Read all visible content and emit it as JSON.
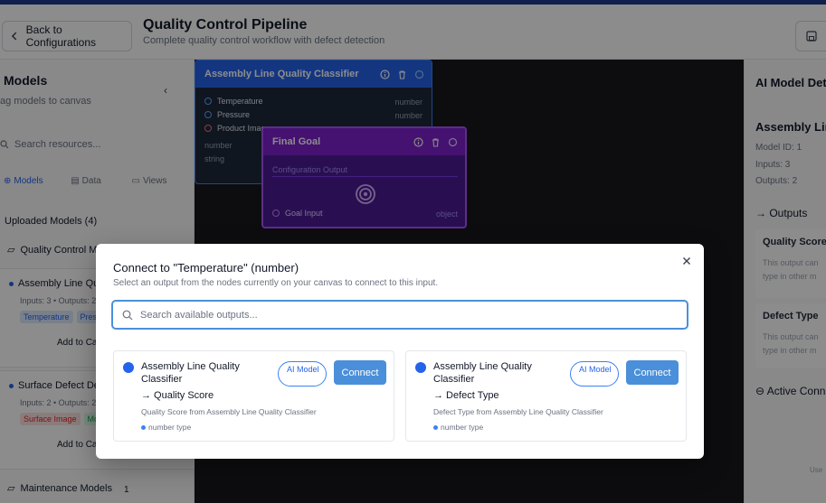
{
  "header": {
    "back_label": "Back to Configurations",
    "title": "Quality Control Pipeline",
    "subtitle": "Complete quality control workflow with defect detection"
  },
  "sidebar": {
    "title": "Models",
    "subtitle": "ag models to canvas",
    "search_placeholder": "Search resources...",
    "tabs": [
      "Models",
      "Data",
      "Views"
    ],
    "section_title": "Uploaded Models (4)",
    "folder": "Quality Control M",
    "cards": [
      {
        "name": "Assembly Line Qu",
        "meta": "Inputs: 3 • Outputs: 2",
        "tags": [
          "Temperature",
          "Pres"
        ],
        "add_label": "Add to Ca"
      },
      {
        "name": "Surface Defect De",
        "meta": "Inputs: 2 • Outputs: 2",
        "tags": [
          "Surface Image",
          "Mo"
        ],
        "add_label": "Add to Ca"
      }
    ],
    "folder2": "Maintenance Models",
    "folder2_count": "1"
  },
  "canvas": {
    "node1": {
      "title": "Assembly Line Quality Classifier",
      "inputs": [
        {
          "name": "Temperature",
          "type": "number"
        },
        {
          "name": "Pressure",
          "type": "number"
        },
        {
          "name": "Product Imag",
          "type": ""
        }
      ],
      "outputs": [
        "number",
        "string"
      ]
    },
    "node2": {
      "title": "Final Goal",
      "config_label": "Configuration Output",
      "input_name": "Goal Input",
      "input_type": "object"
    }
  },
  "right_panel": {
    "title": "AI Model Det",
    "name": "Assembly Lin",
    "model_id": "Model ID: 1",
    "inputs": "Inputs: 3",
    "outputs": "Outputs: 2",
    "outputs_heading": "Outputs",
    "output_cards": [
      {
        "title": "Quality Score",
        "desc1": "This output can",
        "desc2": "type in other m"
      },
      {
        "title": "Defect Type",
        "desc1": "This output can",
        "desc2": "type in other m"
      }
    ],
    "active_heading": "Active Conn",
    "use_hint": "Use"
  },
  "modal": {
    "title": "Connect to \"Temperature\" (number)",
    "description": "Select an output from the nodes currently on your canvas to connect to this input.",
    "search_placeholder": "Search available outputs...",
    "options": [
      {
        "name": "Assembly Line Quality Classifier",
        "output": "→ Quality Score",
        "badge": "AI Model",
        "connect_label": "Connect",
        "description": "Quality Score from Assembly Line Quality Classifier",
        "type": "number type"
      },
      {
        "name": "Assembly Line Quality Classifier",
        "output": "→ Defect Type",
        "badge": "AI Model",
        "connect_label": "Connect",
        "description": "Defect Type from Assembly Line Quality Classifier",
        "type": "number type"
      }
    ]
  },
  "colors": {
    "primary": "#2563eb",
    "connect_button": "#4a8fd9",
    "node_blue": "#2563eb",
    "node_purple": "#7e22ce",
    "canvas_bg": "#18191d"
  }
}
